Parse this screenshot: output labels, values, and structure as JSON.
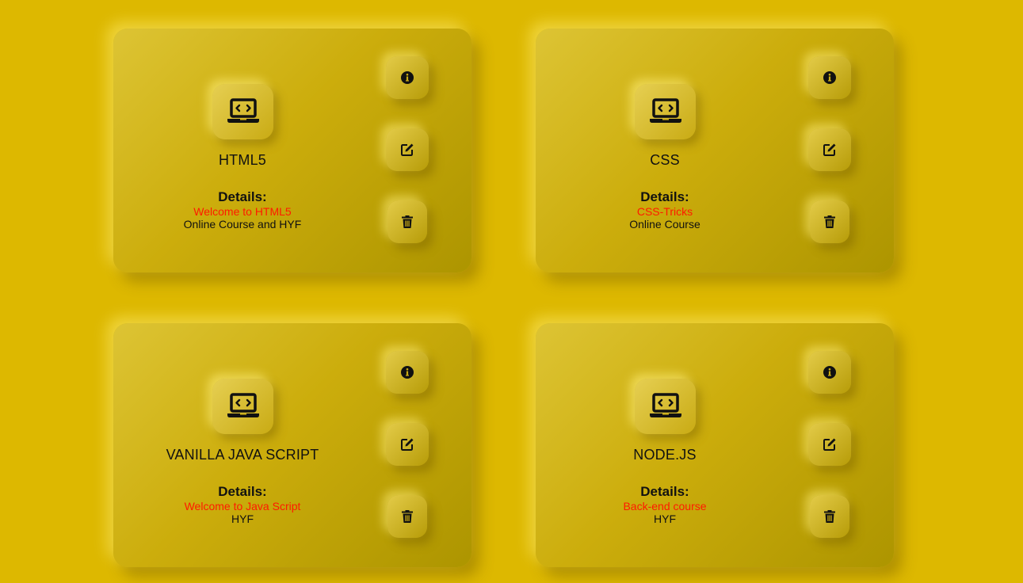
{
  "colors": {
    "background": "#ddb800",
    "card_light": "#ddc434",
    "card_dark": "#ad9500",
    "subtitle_red": "#ff1a00",
    "text": "#111111"
  },
  "icons": {
    "course": "laptop-code-icon",
    "info": "info-circle-icon",
    "edit": "edit-icon",
    "delete": "trash-icon"
  },
  "details_label": "Details:",
  "courses": [
    {
      "title": "HTML5",
      "subtitle": "Welcome to HTML5",
      "description": "Online Course and HYF"
    },
    {
      "title": "CSS",
      "subtitle": "CSS-Tricks",
      "description": "Online Course"
    },
    {
      "title": "VANILLA JAVA SCRIPT",
      "subtitle": "Welcome to Java Script",
      "description": "HYF"
    },
    {
      "title": "NODE.JS",
      "subtitle": "Back-end course",
      "description": "HYF"
    }
  ]
}
